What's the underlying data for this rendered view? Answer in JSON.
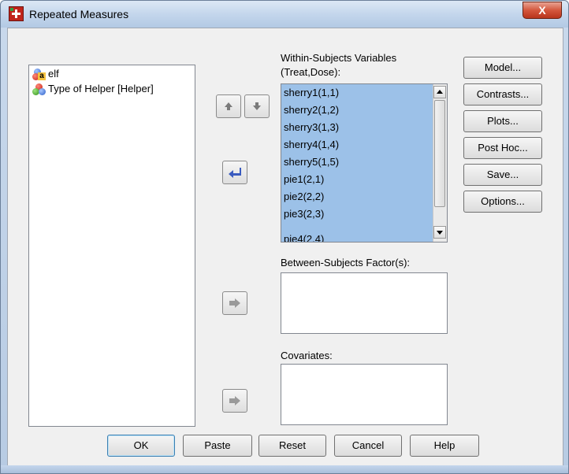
{
  "window": {
    "title": "Repeated Measures",
    "close_glyph": "X"
  },
  "source_list": {
    "items": [
      {
        "label": "elf",
        "icon": "string-variable-icon"
      },
      {
        "label": "Type of Helper [Helper]",
        "icon": "nominal-variable-icon"
      }
    ]
  },
  "within": {
    "label_line1": "Within-Subjects Variables",
    "label_line2": "(Treat,Dose):",
    "items": [
      "sherry1(1,1)",
      "sherry2(1,2)",
      "sherry3(1,3)",
      "sherry4(1,4)",
      "sherry5(1,5)",
      "pie1(2,1)",
      "pie2(2,2)",
      "pie3(2,3)",
      "pie4(2,4)"
    ],
    "selection_color": "#9cc1e8"
  },
  "between": {
    "label": "Between-Subjects Factor(s):"
  },
  "covariates": {
    "label": "Covariates:"
  },
  "side_buttons": {
    "model": "Model...",
    "contrasts": "Contrasts...",
    "plots": "Plots...",
    "post_hoc": "Post Hoc...",
    "save": "Save...",
    "options": "Options..."
  },
  "bottom_buttons": {
    "ok": "OK",
    "paste": "Paste",
    "reset": "Reset",
    "cancel": "Cancel",
    "help": "Help"
  },
  "colors": {
    "accent_arrow": "#3a5bbf",
    "disabled_arrow": "#9a9a9a"
  }
}
